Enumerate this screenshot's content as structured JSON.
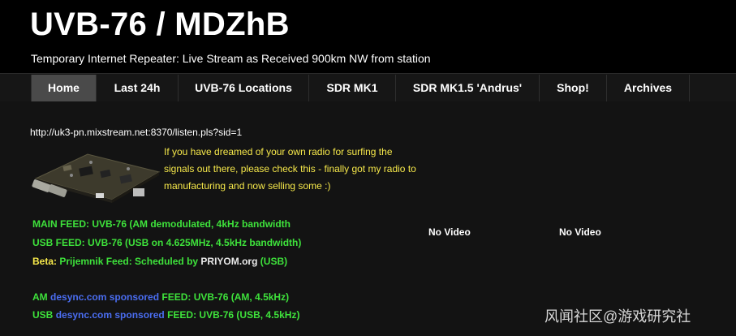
{
  "header": {
    "title": "UVB-76 / MDZhB",
    "tagline": "Temporary Internet Repeater: Live Stream as Received 900km NW from station"
  },
  "nav": {
    "items": [
      {
        "label": "Home",
        "active": true
      },
      {
        "label": "Last 24h",
        "active": false
      },
      {
        "label": "UVB-76 Locations",
        "active": false
      },
      {
        "label": "SDR MK1",
        "active": false
      },
      {
        "label": "SDR MK1.5 'Andrus'",
        "active": false
      },
      {
        "label": "Shop!",
        "active": false
      },
      {
        "label": "Archives",
        "active": false
      }
    ]
  },
  "main": {
    "stream_url": "http://uk3-pn.mixstream.net:8370/listen.pls?sid=1",
    "promo_text": "If you have dreamed of your own radio for surfing the signals out there, please check this - finally got my radio to manufacturing and now selling some :)",
    "feeds": {
      "main_feed": "MAIN FEED: UVB-76 (AM demodulated, 4kHz bandwidth",
      "usb_feed": "USB FEED: UVB-76 (USB on 4.625MHz, 4.5kHz bandwidth)",
      "beta_prefix": "Beta:",
      "beta_part1": "Prijemnik Feed: Scheduled by",
      "beta_priyom": "PRIYOM.org",
      "beta_part2": "(USB)",
      "am_prefix": "AM",
      "am_sponsor": "desync.com sponsored",
      "am_feed": "FEED: UVB-76 (AM, 4.5kHz)",
      "usb_prefix": "USB",
      "usb_sponsor": "desync.com sponsored",
      "usb_sponsored_feed": "FEED: UVB-76 (USB, 4.5kHz)"
    },
    "video_1": "No Video",
    "video_2": "No Video"
  },
  "watermark": "风闻社区@游戏研究社",
  "colors": {
    "feed_green": "#3ee23b",
    "promo_yellow": "#f6e84a",
    "sponsor_blue": "#4a6df0",
    "nav_active": "#4a4a4a"
  }
}
